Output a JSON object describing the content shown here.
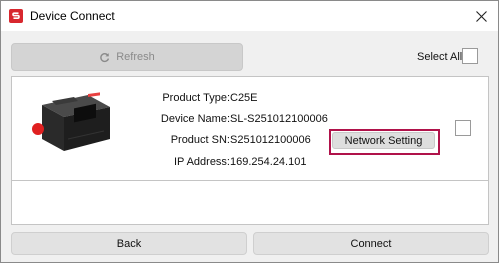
{
  "window": {
    "title": "Device Connect",
    "icon": "brand-logo-icon",
    "close_icon": "close-icon"
  },
  "toolbar": {
    "refresh_label": "Refresh",
    "refresh_icon": "refresh-icon",
    "refresh_enabled": false,
    "select_all_label": "Select All",
    "select_all_checked": false
  },
  "devices": [
    {
      "labels": {
        "product_type": "Product Type:",
        "device_name": "Device Name:",
        "product_sn": "Product SN:",
        "ip_address": "IP Address:"
      },
      "product_type": "C25E",
      "device_name": "SL-S251012100006",
      "product_sn": "S251012100006",
      "ip_address": "169.254.24.101",
      "network_button_label": "Network Setting",
      "network_button_highlighted": true,
      "checked": false
    }
  ],
  "footer": {
    "back_label": "Back",
    "connect_label": "Connect"
  },
  "colors": {
    "brand_red": "#d8272e",
    "highlight_border": "#b0124a",
    "window_bg": "#f0f0f0"
  }
}
